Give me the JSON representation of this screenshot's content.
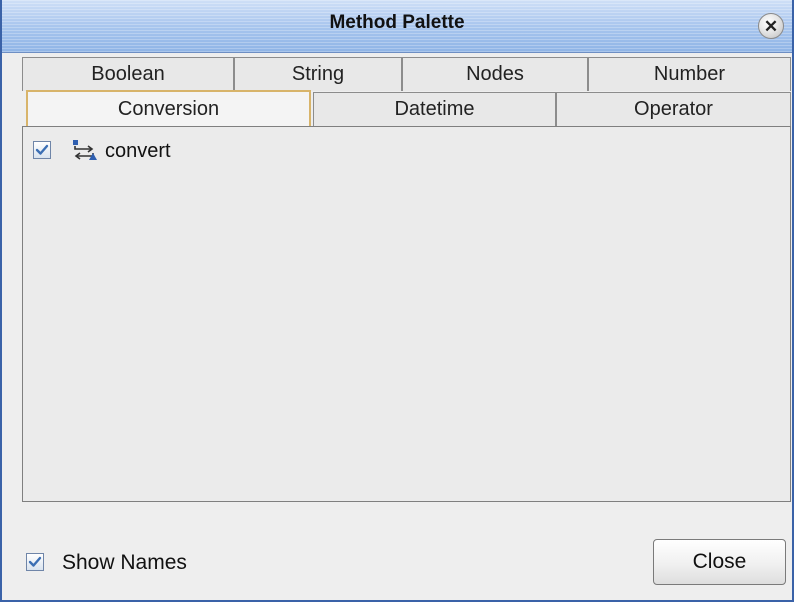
{
  "window": {
    "title": "Method Palette"
  },
  "tabs_row1": [
    {
      "label": "Boolean"
    },
    {
      "label": "String"
    },
    {
      "label": "Nodes"
    },
    {
      "label": "Number"
    }
  ],
  "tabs_row2": [
    {
      "label": "Conversion",
      "selected": true
    },
    {
      "label": "Datetime"
    },
    {
      "label": "Operator"
    }
  ],
  "methods": [
    {
      "label": "convert",
      "checked": true,
      "icon": "convert-arrows-icon"
    }
  ],
  "footer": {
    "show_names_label": "Show Names",
    "show_names_checked": true,
    "close_label": "Close"
  },
  "colors": {
    "titlebar_blue": "#a9c6ee",
    "window_border": "#3a62a8",
    "selected_tab_outline": "#d8b46a",
    "check_blue": "#3c6fb4"
  }
}
